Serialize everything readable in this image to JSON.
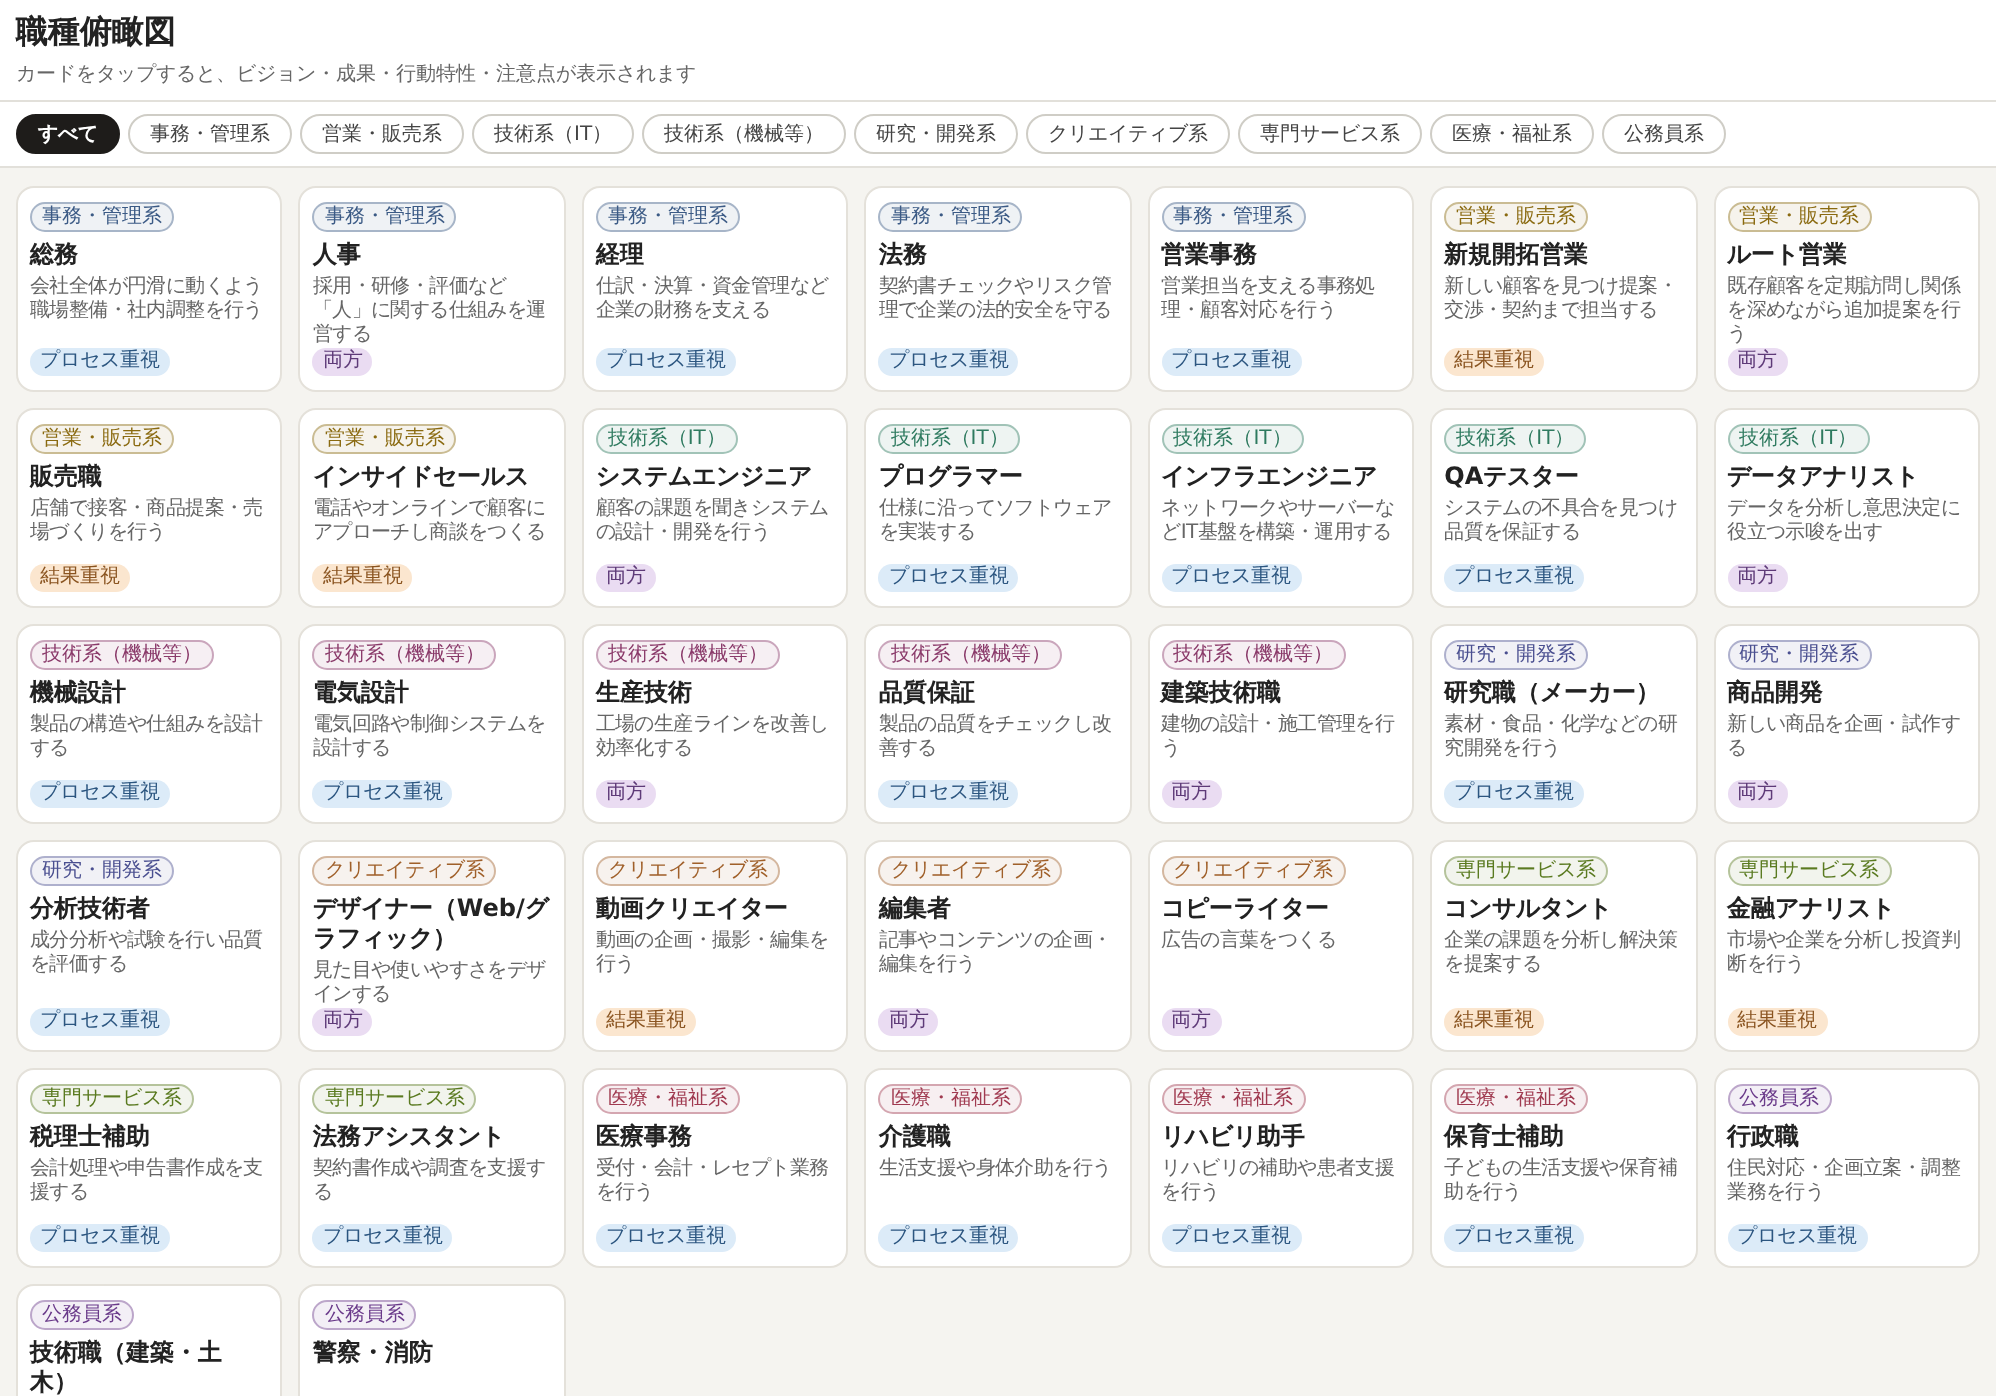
{
  "header": {
    "title": "職種俯瞰図",
    "subtitle": "カードをタップすると、ビジョン・成果・行動特性・注意点が表示されます"
  },
  "filters": [
    {
      "label": "すべて",
      "selected": true
    },
    {
      "label": "事務・管理系",
      "selected": false
    },
    {
      "label": "営業・販売系",
      "selected": false
    },
    {
      "label": "技術系（IT）",
      "selected": false
    },
    {
      "label": "技術系（機械等）",
      "selected": false
    },
    {
      "label": "研究・開発系",
      "selected": false
    },
    {
      "label": "クリエイティブ系",
      "selected": false
    },
    {
      "label": "専門サービス系",
      "selected": false
    },
    {
      "label": "医療・福祉系",
      "selected": false
    },
    {
      "label": "公務員系",
      "selected": false
    }
  ],
  "cards": [
    {
      "category": {
        "label": "事務・管理系",
        "color": "#3b5a85"
      },
      "title": "総務",
      "description": "会社全体が円滑に動くよう職場整備・社内調整を行う",
      "focus": {
        "label": "プロセス重視",
        "kind": "process"
      }
    },
    {
      "category": {
        "label": "事務・管理系",
        "color": "#3b5a85"
      },
      "title": "人事",
      "description": "採用・研修・評価など「人」に関する仕組みを運営する",
      "focus": {
        "label": "両方",
        "kind": "both"
      }
    },
    {
      "category": {
        "label": "事務・管理系",
        "color": "#3b5a85"
      },
      "title": "経理",
      "description": "仕訳・決算・資金管理など企業の財務を支える",
      "focus": {
        "label": "プロセス重視",
        "kind": "process"
      }
    },
    {
      "category": {
        "label": "事務・管理系",
        "color": "#3b5a85"
      },
      "title": "法務",
      "description": "契約書チェックやリスク管理で企業の法的安全を守る",
      "focus": {
        "label": "プロセス重視",
        "kind": "process"
      }
    },
    {
      "category": {
        "label": "事務・管理系",
        "color": "#3b5a85"
      },
      "title": "営業事務",
      "description": "営業担当を支える事務処理・顧客対応を行う",
      "focus": {
        "label": "プロセス重視",
        "kind": "process"
      }
    },
    {
      "category": {
        "label": "営業・販売系",
        "color": "#8a6a10"
      },
      "title": "新規開拓営業",
      "description": "新しい顧客を見つけ提案・交渉・契約まで担当する",
      "focus": {
        "label": "結果重視",
        "kind": "result"
      }
    },
    {
      "category": {
        "label": "営業・販売系",
        "color": "#8a6a10"
      },
      "title": "ルート営業",
      "description": "既存顧客を定期訪問し関係を深めながら追加提案を行う",
      "focus": {
        "label": "両方",
        "kind": "both"
      }
    },
    {
      "category": {
        "label": "営業・販売系",
        "color": "#8a6a10"
      },
      "title": "販売職",
      "description": "店舗で接客・商品提案・売場づくりを行う",
      "focus": {
        "label": "結果重視",
        "kind": "result"
      }
    },
    {
      "category": {
        "label": "営業・販売系",
        "color": "#8a6a10"
      },
      "title": "インサイドセールス",
      "description": "電話やオンラインで顧客にアプローチし商談をつくる",
      "focus": {
        "label": "結果重視",
        "kind": "result"
      }
    },
    {
      "category": {
        "label": "技術系（IT）",
        "color": "#2e7a5f"
      },
      "title": "システムエンジニア",
      "description": "顧客の課題を聞きシステムの設計・開発を行う",
      "focus": {
        "label": "両方",
        "kind": "both"
      }
    },
    {
      "category": {
        "label": "技術系（IT）",
        "color": "#2e7a5f"
      },
      "title": "プログラマー",
      "description": "仕様に沿ってソフトウェアを実装する",
      "focus": {
        "label": "プロセス重視",
        "kind": "process"
      }
    },
    {
      "category": {
        "label": "技術系（IT）",
        "color": "#2e7a5f"
      },
      "title": "インフラエンジニア",
      "description": "ネットワークやサーバーなどIT基盤を構築・運用する",
      "focus": {
        "label": "プロセス重視",
        "kind": "process"
      }
    },
    {
      "category": {
        "label": "技術系（IT）",
        "color": "#2e7a5f"
      },
      "title": "QAテスター",
      "description": "システムの不具合を見つけ品質を保証する",
      "focus": {
        "label": "プロセス重視",
        "kind": "process"
      }
    },
    {
      "category": {
        "label": "技術系（IT）",
        "color": "#2e7a5f"
      },
      "title": "データアナリスト",
      "description": "データを分析し意思決定に役立つ示唆を出す",
      "focus": {
        "label": "両方",
        "kind": "both"
      }
    },
    {
      "category": {
        "label": "技術系（機械等）",
        "color": "#8a3a6a"
      },
      "title": "機械設計",
      "description": "製品の構造や仕組みを設計する",
      "focus": {
        "label": "プロセス重視",
        "kind": "process"
      }
    },
    {
      "category": {
        "label": "技術系（機械等）",
        "color": "#8a3a6a"
      },
      "title": "電気設計",
      "description": "電気回路や制御システムを設計する",
      "focus": {
        "label": "プロセス重視",
        "kind": "process"
      }
    },
    {
      "category": {
        "label": "技術系（機械等）",
        "color": "#8a3a6a"
      },
      "title": "生産技術",
      "description": "工場の生産ラインを改善し効率化する",
      "focus": {
        "label": "両方",
        "kind": "both"
      }
    },
    {
      "category": {
        "label": "技術系（機械等）",
        "color": "#8a3a6a"
      },
      "title": "品質保証",
      "description": "製品の品質をチェックし改善する",
      "focus": {
        "label": "プロセス重視",
        "kind": "process"
      }
    },
    {
      "category": {
        "label": "技術系（機械等）",
        "color": "#8a3a6a"
      },
      "title": "建築技術職",
      "description": "建物の設計・施工管理を行う",
      "focus": {
        "label": "両方",
        "kind": "both"
      }
    },
    {
      "category": {
        "label": "研究・開発系",
        "color": "#4a4f90"
      },
      "title": "研究職（メーカー）",
      "description": "素材・食品・化学などの研究開発を行う",
      "focus": {
        "label": "プロセス重視",
        "kind": "process"
      }
    },
    {
      "category": {
        "label": "研究・開発系",
        "color": "#4a4f90"
      },
      "title": "商品開発",
      "description": "新しい商品を企画・試作する",
      "focus": {
        "label": "両方",
        "kind": "both"
      }
    },
    {
      "category": {
        "label": "研究・開発系",
        "color": "#4a4f90"
      },
      "title": "分析技術者",
      "description": "成分分析や試験を行い品質を評価する",
      "focus": {
        "label": "プロセス重視",
        "kind": "process"
      }
    },
    {
      "category": {
        "label": "クリエイティブ系",
        "color": "#a0602a"
      },
      "title": "デザイナー（Web/グラフィック）",
      "description": "見た目や使いやすさをデザインする",
      "focus": {
        "label": "両方",
        "kind": "both"
      }
    },
    {
      "category": {
        "label": "クリエイティブ系",
        "color": "#a0602a"
      },
      "title": "動画クリエイター",
      "description": "動画の企画・撮影・編集を行う",
      "focus": {
        "label": "結果重視",
        "kind": "result"
      }
    },
    {
      "category": {
        "label": "クリエイティブ系",
        "color": "#a0602a"
      },
      "title": "編集者",
      "description": "記事やコンテンツの企画・編集を行う",
      "focus": {
        "label": "両方",
        "kind": "both"
      }
    },
    {
      "category": {
        "label": "クリエイティブ系",
        "color": "#a0602a"
      },
      "title": "コピーライター",
      "description": "広告の言葉をつくる",
      "focus": {
        "label": "両方",
        "kind": "both"
      }
    },
    {
      "category": {
        "label": "専門サービス系",
        "color": "#5a7a20"
      },
      "title": "コンサルタント",
      "description": "企業の課題を分析し解決策を提案する",
      "focus": {
        "label": "結果重視",
        "kind": "result"
      }
    },
    {
      "category": {
        "label": "専門サービス系",
        "color": "#5a7a20"
      },
      "title": "金融アナリスト",
      "description": "市場や企業を分析し投資判断を行う",
      "focus": {
        "label": "結果重視",
        "kind": "result"
      }
    },
    {
      "category": {
        "label": "専門サービス系",
        "color": "#5a7a20"
      },
      "title": "税理士補助",
      "description": "会計処理や申告書作成を支援する",
      "focus": {
        "label": "プロセス重視",
        "kind": "process"
      }
    },
    {
      "category": {
        "label": "専門サービス系",
        "color": "#5a7a20"
      },
      "title": "法務アシスタント",
      "description": "契約書作成や調査を支援する",
      "focus": {
        "label": "プロセス重視",
        "kind": "process"
      }
    },
    {
      "category": {
        "label": "医療・福祉系",
        "color": "#a03a50"
      },
      "title": "医療事務",
      "description": "受付・会計・レセプト業務を行う",
      "focus": {
        "label": "プロセス重視",
        "kind": "process"
      }
    },
    {
      "category": {
        "label": "医療・福祉系",
        "color": "#a03a50"
      },
      "title": "介護職",
      "description": "生活支援や身体介助を行う",
      "focus": {
        "label": "プロセス重視",
        "kind": "process"
      }
    },
    {
      "category": {
        "label": "医療・福祉系",
        "color": "#a03a50"
      },
      "title": "リハビリ助手",
      "description": "リハビリの補助や患者支援を行う",
      "focus": {
        "label": "プロセス重視",
        "kind": "process"
      }
    },
    {
      "category": {
        "label": "医療・福祉系",
        "color": "#a03a50"
      },
      "title": "保育士補助",
      "description": "子どもの生活支援や保育補助を行う",
      "focus": {
        "label": "プロセス重視",
        "kind": "process"
      }
    },
    {
      "category": {
        "label": "公務員系",
        "color": "#6a3a8a"
      },
      "title": "行政職",
      "description": "住民対応・企画立案・調整業務を行う",
      "focus": {
        "label": "プロセス重視",
        "kind": "process"
      }
    },
    {
      "category": {
        "label": "公務員系",
        "color": "#6a3a8a"
      },
      "title": "技術職（建築・土木）"
    },
    {
      "category": {
        "label": "公務員系",
        "color": "#6a3a8a"
      },
      "title": "警察・消防"
    }
  ]
}
